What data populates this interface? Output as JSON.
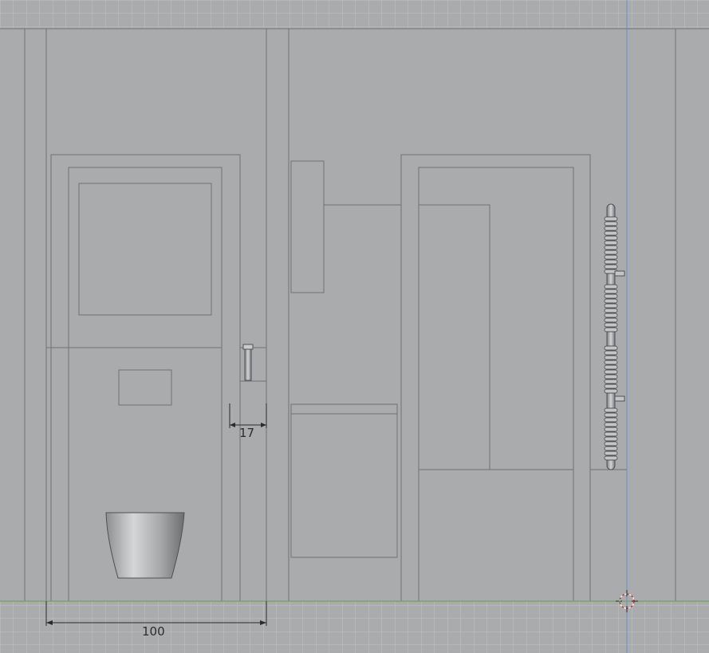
{
  "viewport": {
    "view": "front-elevation",
    "colors": {
      "background": "#a9abad",
      "grid_line": "#bfc1c3",
      "edge_line": "#6f7173",
      "ground_axis": "#6aa84f",
      "vertical_axis": "#6c8fd0",
      "dimension": "#2b2b2b",
      "cursor": "#d12c2c"
    }
  },
  "dimensions": {
    "toilet_width": "100",
    "gap_width": "17"
  },
  "objects": {
    "toilet": "wall-hung-toilet",
    "tap": "wall-tap",
    "radiator": "towel-radiator",
    "cursor": "3d-cursor-icon"
  }
}
